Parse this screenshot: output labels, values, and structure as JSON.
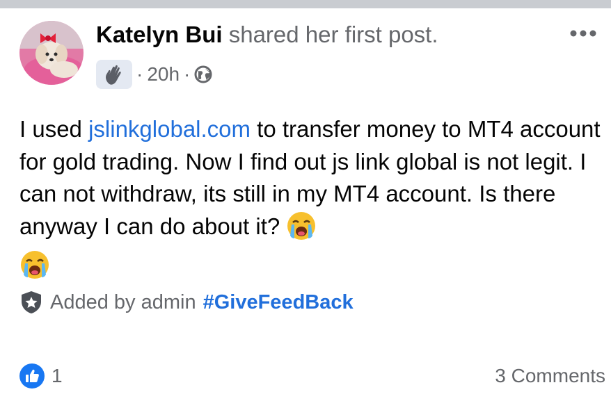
{
  "post": {
    "author_name": "Katelyn Bui",
    "action_text": "shared her first post.",
    "time": "20h",
    "separator": "·",
    "badge_icon": "waving-hand-icon",
    "privacy_icon": "globe-icon",
    "body_prefix": "I used ",
    "body_link": "jslinkglobal.com",
    "body_suffix": " to transfer money to MT4 account for gold trading. Now I find out js link global is not legit. I can not withdraw, its still in my MT4 account. Is there anyway I can do about it? ",
    "emoji": "loudly-crying-face-icon",
    "added_by_text": "Added by admin",
    "hashtag": "#GiveFeedBack"
  },
  "footer": {
    "reaction_icon": "like-icon",
    "reaction_count": "1",
    "comments": "3 Comments"
  },
  "colors": {
    "link": "#216fdb",
    "secondary_text": "#65676b",
    "like_blue": "#1877f2",
    "top_bar": "#c9ccd1"
  }
}
